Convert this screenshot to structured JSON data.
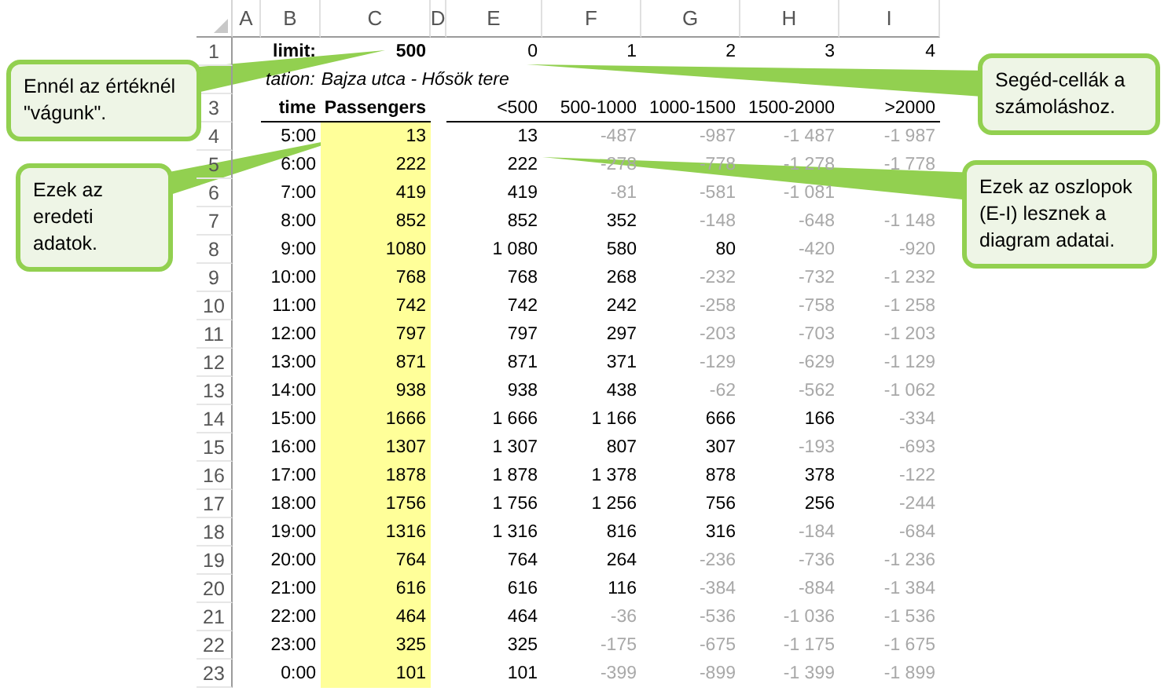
{
  "column_headers": [
    "A",
    "B",
    "C",
    "D",
    "E",
    "F",
    "G",
    "H",
    "I"
  ],
  "limit": {
    "row": "1",
    "label": "limit:",
    "value": "500",
    "steps": [
      "0",
      "1",
      "2",
      "3",
      "4"
    ]
  },
  "station": {
    "label": "tation:",
    "name": "Bajza utca - Hősök tere"
  },
  "header": {
    "row": "3",
    "time": "time",
    "passengers": "Passengers",
    "ranges": [
      "<500",
      "500-1000",
      "1000-1500",
      "1500-2000",
      ">2000"
    ]
  },
  "rows": [
    {
      "row": "4",
      "time": "5:00",
      "passengers": "13",
      "values": [
        "13",
        "-487",
        "-987",
        "-1 487",
        "-1 987"
      ],
      "muted": [
        false,
        true,
        true,
        true,
        true
      ]
    },
    {
      "row": "5",
      "time": "6:00",
      "passengers": "222",
      "values": [
        "222",
        "-278",
        "-778",
        "-1 278",
        "-1 778"
      ],
      "muted": [
        false,
        true,
        true,
        true,
        true
      ]
    },
    {
      "row": "6",
      "time": "7:00",
      "passengers": "419",
      "values": [
        "419",
        "-81",
        "-581",
        "-1 081"
      ],
      "muted": [
        false,
        true,
        true,
        true
      ]
    },
    {
      "row": "7",
      "time": "8:00",
      "passengers": "852",
      "values": [
        "852",
        "352",
        "-148",
        "-648",
        "-1 148"
      ],
      "muted": [
        false,
        false,
        true,
        true,
        true
      ]
    },
    {
      "row": "8",
      "time": "9:00",
      "passengers": "1080",
      "values": [
        "1 080",
        "580",
        "80",
        "-420",
        "-920"
      ],
      "muted": [
        false,
        false,
        false,
        true,
        true
      ]
    },
    {
      "row": "9",
      "time": "10:00",
      "passengers": "768",
      "values": [
        "768",
        "268",
        "-232",
        "-732",
        "-1 232"
      ],
      "muted": [
        false,
        false,
        true,
        true,
        true
      ]
    },
    {
      "row": "10",
      "time": "11:00",
      "passengers": "742",
      "values": [
        "742",
        "242",
        "-258",
        "-758",
        "-1 258"
      ],
      "muted": [
        false,
        false,
        true,
        true,
        true
      ]
    },
    {
      "row": "11",
      "time": "12:00",
      "passengers": "797",
      "values": [
        "797",
        "297",
        "-203",
        "-703",
        "-1 203"
      ],
      "muted": [
        false,
        false,
        true,
        true,
        true
      ]
    },
    {
      "row": "12",
      "time": "13:00",
      "passengers": "871",
      "values": [
        "871",
        "371",
        "-129",
        "-629",
        "-1 129"
      ],
      "muted": [
        false,
        false,
        true,
        true,
        true
      ]
    },
    {
      "row": "13",
      "time": "14:00",
      "passengers": "938",
      "values": [
        "938",
        "438",
        "-62",
        "-562",
        "-1 062"
      ],
      "muted": [
        false,
        false,
        true,
        true,
        true
      ]
    },
    {
      "row": "14",
      "time": "15:00",
      "passengers": "1666",
      "values": [
        "1 666",
        "1 166",
        "666",
        "166",
        "-334"
      ],
      "muted": [
        false,
        false,
        false,
        false,
        true
      ]
    },
    {
      "row": "15",
      "time": "16:00",
      "passengers": "1307",
      "values": [
        "1 307",
        "807",
        "307",
        "-193",
        "-693"
      ],
      "muted": [
        false,
        false,
        false,
        true,
        true
      ]
    },
    {
      "row": "16",
      "time": "17:00",
      "passengers": "1878",
      "values": [
        "1 878",
        "1 378",
        "878",
        "378",
        "-122"
      ],
      "muted": [
        false,
        false,
        false,
        false,
        true
      ]
    },
    {
      "row": "17",
      "time": "18:00",
      "passengers": "1756",
      "values": [
        "1 756",
        "1 256",
        "756",
        "256",
        "-244"
      ],
      "muted": [
        false,
        false,
        false,
        false,
        true
      ]
    },
    {
      "row": "18",
      "time": "19:00",
      "passengers": "1316",
      "values": [
        "1 316",
        "816",
        "316",
        "-184",
        "-684"
      ],
      "muted": [
        false,
        false,
        false,
        true,
        true
      ]
    },
    {
      "row": "19",
      "time": "20:00",
      "passengers": "764",
      "values": [
        "764",
        "264",
        "-236",
        "-736",
        "-1 236"
      ],
      "muted": [
        false,
        false,
        true,
        true,
        true
      ]
    },
    {
      "row": "20",
      "time": "21:00",
      "passengers": "616",
      "values": [
        "616",
        "116",
        "-384",
        "-884",
        "-1 384"
      ],
      "muted": [
        false,
        false,
        true,
        true,
        true
      ]
    },
    {
      "row": "21",
      "time": "22:00",
      "passengers": "464",
      "values": [
        "464",
        "-36",
        "-536",
        "-1 036",
        "-1 536"
      ],
      "muted": [
        false,
        true,
        true,
        true,
        true
      ]
    },
    {
      "row": "22",
      "time": "23:00",
      "passengers": "325",
      "values": [
        "325",
        "-175",
        "-675",
        "-1 175",
        "-1 675"
      ],
      "muted": [
        false,
        true,
        true,
        true,
        true
      ]
    },
    {
      "row": "23",
      "time": "0:00",
      "passengers": "101",
      "values": [
        "101",
        "-399",
        "-899",
        "-1 399",
        "-1 899"
      ],
      "muted": [
        false,
        true,
        true,
        true,
        true
      ]
    }
  ],
  "callouts": [
    {
      "text": "Ennél az értéknél \"vágunk\"."
    },
    {
      "text": "Segéd-cellák a számoláshoz."
    },
    {
      "text": "Ezek az eredeti adatok."
    },
    {
      "text": "Ezek az oszlopok (E-I) lesznek a diagram adatai."
    }
  ]
}
